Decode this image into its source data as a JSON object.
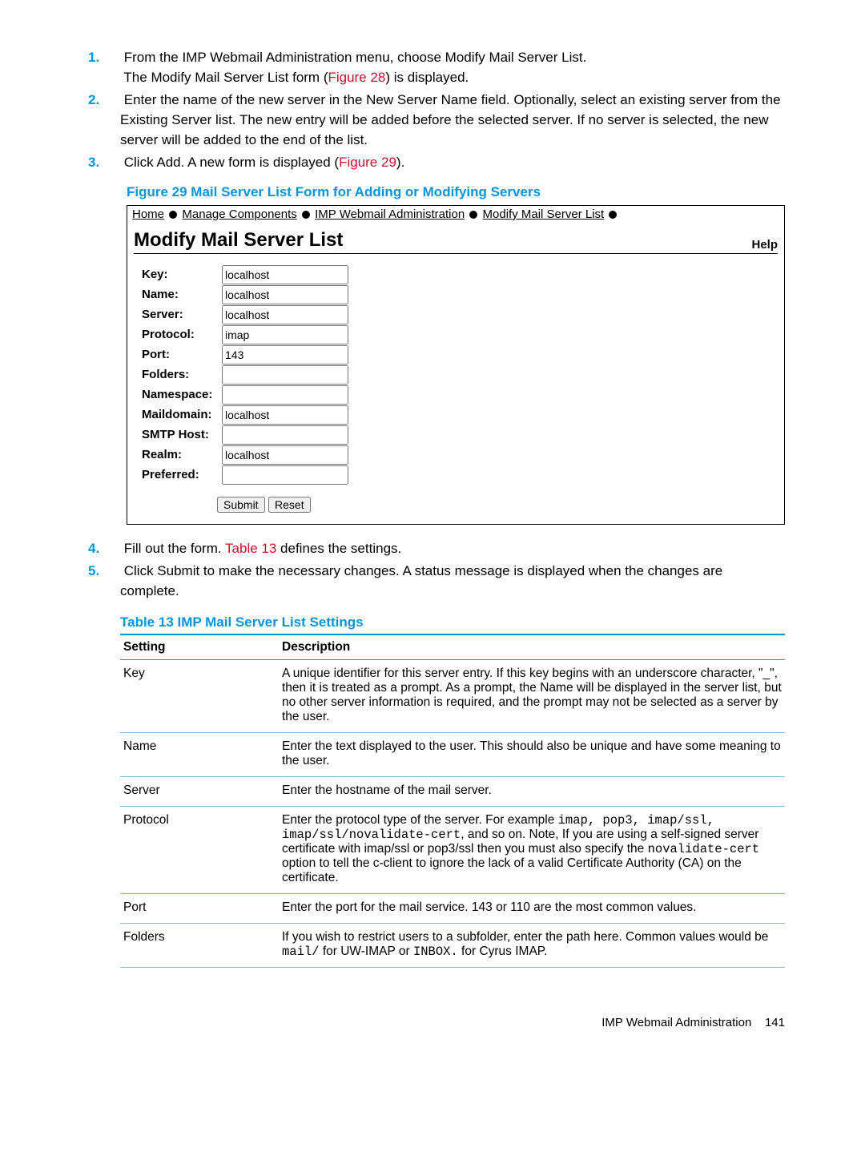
{
  "steps": {
    "s1_num": "1.",
    "s1_a": "From the IMP Webmail Administration menu, choose Modify Mail Server List.",
    "s1_b_pre": "The Modify Mail Server List form (",
    "s1_b_link": "Figure 28",
    "s1_b_post": ") is displayed.",
    "s2_num": "2.",
    "s2": "Enter the name of the new server in the New Server Name field. Optionally, select an existing server from the Existing Server list. The new entry will be added before the selected server. If no server is selected, the new server will be added to the end of the list.",
    "s3_num": "3.",
    "s3_pre": "Click Add. A new form is displayed (",
    "s3_link": "Figure 29",
    "s3_post": ").",
    "s4_num": "4.",
    "s4_pre": "Fill out the form. ",
    "s4_link": "Table 13",
    "s4_post": " defines the settings.",
    "s5_num": "5.",
    "s5": "Click Submit to make the necessary changes. A status message is displayed when the changes are complete."
  },
  "figure": {
    "caption": "Figure 29 Mail Server List Form for Adding or Modifying Servers",
    "breadcrumb": {
      "home": "Home",
      "manage": "Manage Components",
      "imp": "IMP Webmail Administration",
      "modify": "Modify Mail Server List"
    },
    "title": "Modify Mail Server List",
    "help": "Help",
    "labels": {
      "key": "Key:",
      "name": "Name:",
      "server": "Server:",
      "protocol": "Protocol:",
      "port": "Port:",
      "folders": "Folders:",
      "namespace": "Namespace:",
      "maildomain": "Maildomain:",
      "smtphost": "SMTP Host:",
      "realm": "Realm:",
      "preferred": "Preferred:"
    },
    "values": {
      "key": "localhost",
      "name": "localhost",
      "server": "localhost",
      "protocol": "imap",
      "port": "143",
      "folders": "",
      "namespace": "",
      "maildomain": "localhost",
      "smtphost": "",
      "realm": "localhost",
      "preferred": ""
    },
    "submit": "Submit",
    "reset": "Reset"
  },
  "table": {
    "caption": "Table 13 IMP Mail Server List Settings",
    "h_setting": "Setting",
    "h_desc": "Description",
    "rows": {
      "key_s": "Key",
      "key_d": "A unique identifier for this server entry. If this key begins with an underscore character, \"_\", then it is treated as a prompt. As a prompt, the Name will be displayed in the server list, but no other server information is required, and the prompt may not be selected as a server by the user.",
      "name_s": "Name",
      "name_d": "Enter the text displayed to the user. This should also be unique and have some meaning to the user.",
      "server_s": "Server",
      "server_d": "Enter the hostname of the mail server.",
      "protocol_s": "Protocol",
      "protocol_d_pre": "Enter the protocol type of the server. For example ",
      "protocol_d_code1": "imap, pop3, imap/ssl, imap/ssl/novalidate-cert",
      "protocol_d_mid1": ", and so on. Note, If you are using a self-signed server certificate with imap/ssl or pop3/ssl then you must also specify the ",
      "protocol_d_code2": "novalidate-cert",
      "protocol_d_mid2": " option to tell the c-client to ignore the lack of a valid Certificate Authority (CA) on the certificate.",
      "port_s": "Port",
      "port_d": "Enter the port for the mail service. 143 or 110 are the most common values.",
      "folders_s": "Folders",
      "folders_d_pre": "If you wish to restrict users to a subfolder, enter the path here. Common values would be ",
      "folders_d_code1": "mail/",
      "folders_d_mid": " for UW-IMAP or ",
      "folders_d_code2": "INBOX.",
      "folders_d_post": " for Cyrus IMAP."
    }
  },
  "footer": {
    "text": "IMP Webmail Administration",
    "page": "141"
  }
}
